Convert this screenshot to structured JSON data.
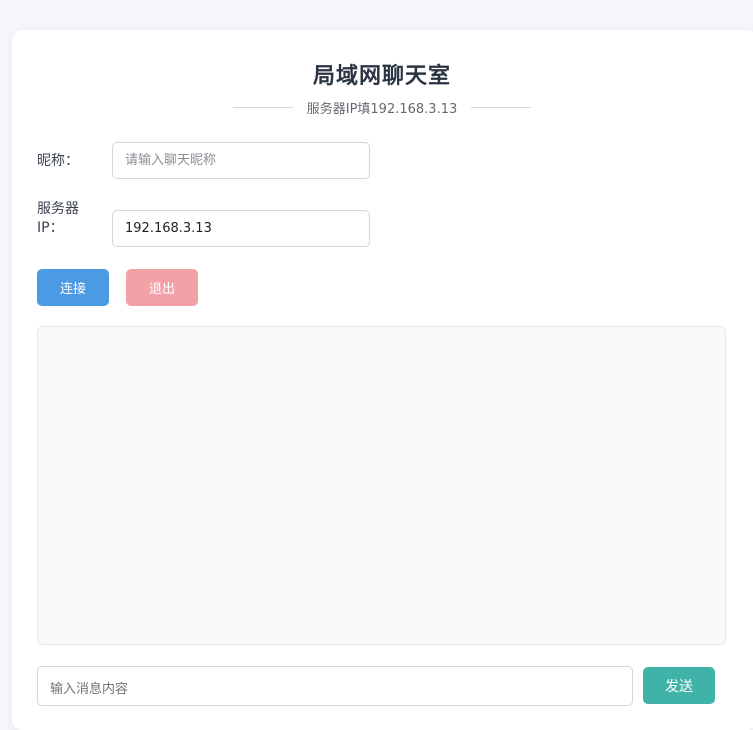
{
  "app": {
    "title": "局域网聊天室",
    "subtitle": "服务器IP填192.168.3.13"
  },
  "form": {
    "nickname_label": "昵称：",
    "nickname_placeholder": "请输入聊天昵称",
    "nickname_value": "",
    "server_label_line1": "服务器",
    "server_label_line2": "IP：",
    "server_value": "192.168.3.13"
  },
  "actions": {
    "connect_label": "连接",
    "exit_label": "退出"
  },
  "chat": {
    "messages": []
  },
  "composer": {
    "placeholder": "输入消息内容",
    "send_label": "发送"
  },
  "colors": {
    "connect": "#4a9be3",
    "exit": "#f2a2a6",
    "send": "#3fb3a7"
  }
}
